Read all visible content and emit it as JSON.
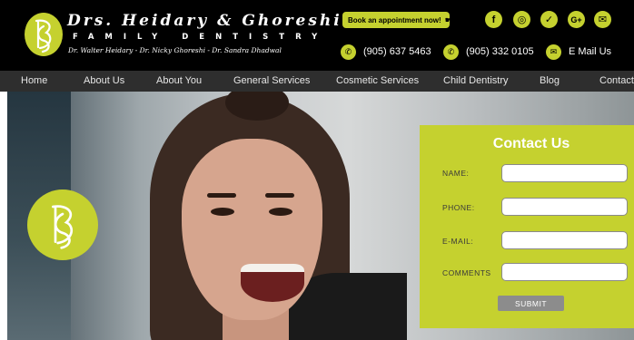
{
  "brand": {
    "name": "Drs. Heidary & Ghoreshi",
    "subtitle": "FAMILY DENTISTRY",
    "doctors": "Dr. Walter Heidary - Dr. Nicky Ghoreshi - Dr. Sandra Dhadwal",
    "accent_color": "#c5d12f"
  },
  "header": {
    "appointment_button": "Book an appointment now!",
    "social_icons": [
      "facebook-icon",
      "instagram-icon",
      "twitter-icon",
      "google-plus-icon",
      "email-icon"
    ],
    "phone_1": "(905) 637 5463",
    "phone_2": "(905) 332 0105",
    "email_label": "E Mail Us"
  },
  "nav": {
    "items": [
      "Home",
      "About Us",
      "About You",
      "General Services",
      "Cosmetic Services",
      "Child Dentistry",
      "Blog",
      "Contact"
    ]
  },
  "contact_form": {
    "title": "Contact Us",
    "fields": [
      {
        "label": "NAME:",
        "value": ""
      },
      {
        "label": "PHONE:",
        "value": ""
      },
      {
        "label": "E-MAIL:",
        "value": ""
      },
      {
        "label": "COMMENTS",
        "value": ""
      }
    ],
    "submit_label": "SUBMIT"
  }
}
